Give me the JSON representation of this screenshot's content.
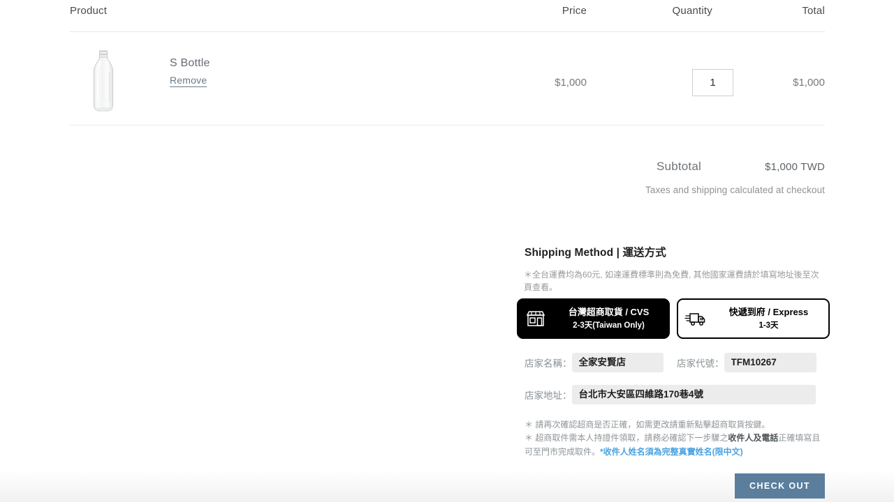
{
  "cart": {
    "columns": {
      "product": "Product",
      "price": "Price",
      "quantity": "Quantity",
      "total": "Total"
    },
    "items": [
      {
        "title": "S Bottle",
        "remove_label": "Remove",
        "price": "$1,000",
        "quantity": "1",
        "total": "$1,000",
        "thumbnail_icon": "glass-bottle-photo"
      }
    ]
  },
  "totals": {
    "subtotal_label": "Subtotal",
    "subtotal_value": "$1,000 TWD",
    "tax_note": "Taxes and shipping calculated at checkout"
  },
  "shipping": {
    "title": "Shipping Method | 運送方式",
    "note": "＊全台運費均為60元, 如達運費標準則為免費, 其他國家運費請於填寫地址後至次頁查看。",
    "options": [
      {
        "icon": "storefront-icon",
        "line1": "台灣超商取貨 / CVS",
        "line2": "2-3天(Taiwan Only)",
        "selected": true
      },
      {
        "icon": "delivery-truck-icon",
        "line1": "快遞到府 / Express",
        "line2": "1-3天",
        "selected": false
      }
    ],
    "fields": {
      "store_name_label": "店家名稱：",
      "store_name_value": "全家安賢店",
      "store_code_label": "店家代號：",
      "store_code_value": "TFM10267",
      "store_address_label": "店家地址：",
      "store_address_value": "台北市大安區四維路170巷4號"
    },
    "warnings": {
      "line1": "＊ 請再次確認超商是否正確，如需更改請重新點擊超商取貨按鍵。",
      "line2_a": "＊ 超商取件需本人持證件領取，請務必確認下一步驟之",
      "line2_b": "收件人及電話",
      "line2_c": "正確填寫且可至門市完成取件。",
      "line2_highlight": "*收件人姓名須為完整真實姓名(限中文)"
    }
  },
  "footer": {
    "checkout_label": "CHECK OUT"
  },
  "colors": {
    "checkout_button": "#5b7e9c",
    "selected_option_bg": "#000000",
    "highlight_text": "#4aa3e0",
    "field_bg": "#ececec"
  }
}
